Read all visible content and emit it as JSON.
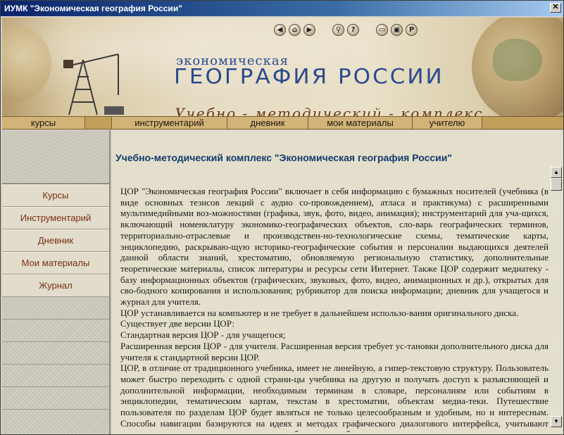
{
  "window": {
    "title": "ИУМК \"Экономическая география России\"",
    "close_label": "✕"
  },
  "header": {
    "logo_top": "экономическая",
    "logo_main": "ГЕОГРАФИЯ РОССИИ",
    "logo_sub": "Учебно - методический - комплекс",
    "nav_buttons": [
      {
        "name": "back-icon",
        "glyph": "◀"
      },
      {
        "name": "home-icon",
        "glyph": "⌂"
      },
      {
        "name": "forward-icon",
        "glyph": "▶"
      },
      {
        "name": "search-icon",
        "glyph": "⚲"
      },
      {
        "name": "help-icon",
        "glyph": "?"
      },
      {
        "name": "monitor-icon",
        "glyph": "▭"
      },
      {
        "name": "calendar-icon",
        "glyph": "▣"
      },
      {
        "name": "p-icon",
        "glyph": "P"
      }
    ]
  },
  "menubar": {
    "items": [
      "курсы",
      "",
      "инструментарий",
      "дневник",
      "мои материалы",
      "учителю"
    ]
  },
  "sidebar": {
    "items": [
      "Курсы",
      "Инструментарий",
      "Дневник",
      "Мои материалы",
      "Журнал"
    ]
  },
  "main": {
    "title": "Учебно-методический комплекс \"Экономическая география России\"",
    "paragraphs": [
      "ЦОР \"Экономическая география России\" включает в себя информацию с бумажных носителей (учебника (в виде основных тезисов лекций с аудио со-провождением), атласа и практикума) с расширенными мультимедийными воз-можностями (графика, звук, фото, видео, анимация); инструментарий для уча-щихся, включающий номенклатуру экономико-географических объектов, сло-варь географических терминов, территориально-отраслевые и производствен-но-технологические схемы, тематические карты, энциклопедию, раскрываю-щую историко-географические события и персоналии выдающихся деятелей данной области знаний, хрестоматию, обновляемую региональную статистику, дополнительные теоретические материалы, список литературы и ресурсы сети Интернет. Также ЦОР содержит медиатеку - базу информационных объектов (графических, звуковых, фото, видео, анимационных и др.), открытых для сво-бодного копирования и использования; рубрикатор для поиска информации; дневник для учащегося и журнал для учителя.",
      "ЦОР устанавливается на компьютер и не требует в дальнейшем использо-вания оригинального диска.",
      "Существует две версии ЦОР:",
      "Стандартная версия ЦОР - для учащегося;",
      "Расширенная версия ЦОР - для учителя. Расширенная версия требует ус-тановки дополнительного диска для учителя к стандартной версии ЦОР.",
      "ЦОР, в отличие от традиционного учебника, имеет не линейную, а гипер-текстовую структуру. Пользователь может быстро переходить с одной страни-цы учебника на другую и получать доступ к разъясняющей и дополнительной информации, необходимым терминам в словаре, персоналиям или событиям в энциклопедии, тематическим картам, текстам в хрестоматии, объектам медиа-теки. Путешествие пользователя по разделам ЦОР будет являться не только целесообразным и удобным, но и интересным. Способы навигации базируются на идеях и методах графического диалогового интерфейса, учитывают индивиду-ально-психологические аспекты общения с учебником и улучшают"
    ]
  },
  "colors": {
    "title_blue": "#123a6e",
    "sidebar_text": "#7a2f14",
    "menubar": "#d2b378",
    "logo_blue": "#2b4a8c"
  }
}
